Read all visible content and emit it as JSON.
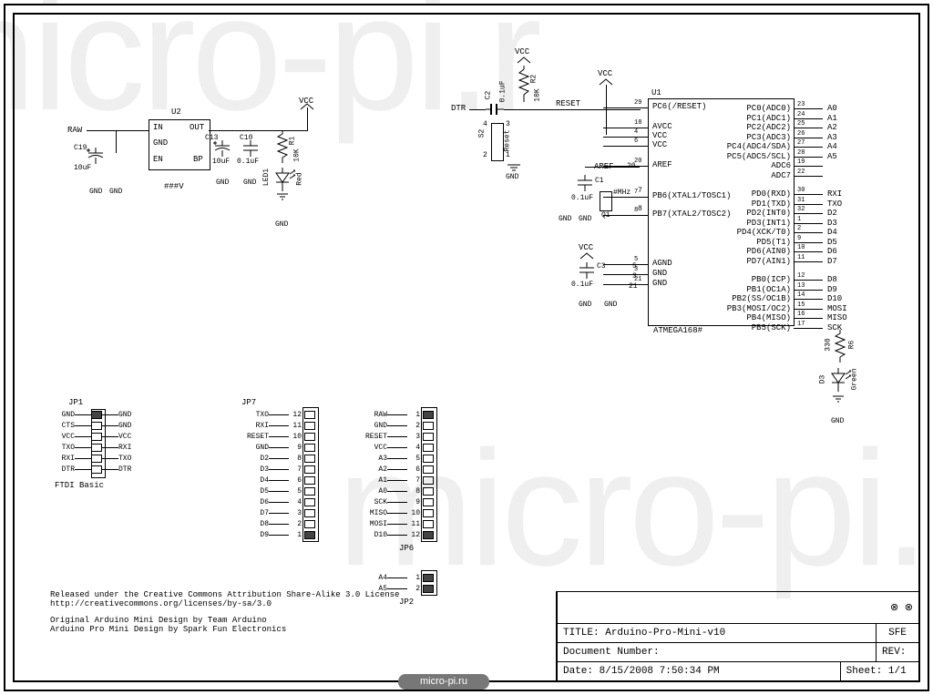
{
  "title_block": {
    "title_label": "TITLE:",
    "title": "Arduino-Pro-Mini-v10",
    "sfe": "SFE",
    "docnum_label": "Document Number:",
    "rev_label": "REV:",
    "date_label": "Date:",
    "date": "8/15/2008 7:50:34 PM",
    "sheet_label": "Sheet:",
    "sheet": "1/1"
  },
  "footer": {
    "license1": "Released under the Creative Commons Attribution Share-Alike 3.0 License",
    "license2": "http://creativecommons.org/licenses/by-sa/3.0",
    "credit1": "Original Arduino Mini Design by Team Arduino",
    "credit2": "Arduino Pro Mini Design by Spark Fun Electronics"
  },
  "watermark": {
    "url": "micro-pi.ru",
    "text": "micro-pi.r"
  },
  "regulator": {
    "u2": "U2",
    "in": "IN",
    "out": "OUT",
    "gnd": "GND",
    "en": "EN",
    "bp": "BP",
    "note": "###V",
    "raw": "RAW",
    "vcc": "VCC",
    "c19": "C19",
    "c19v": "10uF",
    "c13": "C13",
    "c13v": "10uF",
    "c10": "C10",
    "c10v": "0.1uF",
    "r1": "R1",
    "r1v": "10K",
    "led1": "LED1",
    "red": "Red",
    "gnd_lbl": "GND"
  },
  "reset": {
    "dtr": "DTR",
    "vcc": "VCC",
    "reset": "RESET",
    "s2": "S2",
    "s2t": "Reset",
    "c2": "C2",
    "c2v": "0.1uF",
    "r2": "R2",
    "r2v": "10K",
    "gnd": "GND"
  },
  "osc": {
    "aref": "AREF",
    "c1": "C1",
    "c1v": "0.1uF",
    "q1": "Q1",
    "mhz": "#MHz",
    "gnd": "GND",
    "c3": "C3",
    "c3v": "0.1uF",
    "vcc": "VCC"
  },
  "led": {
    "r6": "R6",
    "r6v": "330",
    "d3": "D3",
    "green": "Green",
    "gnd": "GND"
  },
  "ic": {
    "ref": "U1",
    "part": "ATMEGA168#",
    "left": [
      {
        "n": "29",
        "t": "PC6(/RESET)"
      },
      {
        "n": "18",
        "t": "AVCC"
      },
      {
        "n": "4",
        "t": "VCC"
      },
      {
        "n": "6",
        "t": "VCC"
      },
      {
        "n": "20",
        "t": "AREF"
      },
      {
        "n": "7",
        "t": "PB6(XTAL1/TOSC1)"
      },
      {
        "n": "8",
        "t": "PB7(XTAL2/TOSC2)"
      },
      {
        "n": "5",
        "t": "AGND"
      },
      {
        "n": "3",
        "t": "GND"
      },
      {
        "n": "21",
        "t": "GND"
      }
    ],
    "right": [
      {
        "n": "23",
        "t": "PC0(ADC0)",
        "net": "A0"
      },
      {
        "n": "24",
        "t": "PC1(ADC1)",
        "net": "A1"
      },
      {
        "n": "25",
        "t": "PC2(ADC2)",
        "net": "A2"
      },
      {
        "n": "26",
        "t": "PC3(ADC3)",
        "net": "A3"
      },
      {
        "n": "27",
        "t": "PC4(ADC4/SDA)",
        "net": "A4"
      },
      {
        "n": "28",
        "t": "PC5(ADC5/SCL)",
        "net": "A5"
      },
      {
        "n": "19",
        "t": "ADC6",
        "net": ""
      },
      {
        "n": "22",
        "t": "ADC7",
        "net": ""
      },
      {
        "n": "30",
        "t": "PD0(RXD)",
        "net": "RXI"
      },
      {
        "n": "31",
        "t": "PD1(TXD)",
        "net": "TXO"
      },
      {
        "n": "32",
        "t": "PD2(INT0)",
        "net": "D2"
      },
      {
        "n": "1",
        "t": "PD3(INT1)",
        "net": "D3"
      },
      {
        "n": "2",
        "t": "PD4(XCK/T0)",
        "net": "D4"
      },
      {
        "n": "9",
        "t": "PD5(T1)",
        "net": "D5"
      },
      {
        "n": "10",
        "t": "PD6(AIN0)",
        "net": "D6"
      },
      {
        "n": "11",
        "t": "PD7(AIN1)",
        "net": "D7"
      },
      {
        "n": "12",
        "t": "PB0(ICP)",
        "net": "D8"
      },
      {
        "n": "13",
        "t": "PB1(OC1A)",
        "net": "D9"
      },
      {
        "n": "14",
        "t": "PB2(SS/OC1B)",
        "net": "D10"
      },
      {
        "n": "15",
        "t": "PB3(MOSI/OC2)",
        "net": "MOSI"
      },
      {
        "n": "16",
        "t": "PB4(MISO)",
        "net": "MISO"
      },
      {
        "n": "17",
        "t": "PB5(SCK)",
        "net": "SCK"
      }
    ]
  },
  "jp1": {
    "ref": "JP1",
    "note": "FTDI Basic",
    "left": [
      "GND",
      "CTS",
      "VCC",
      "TXO",
      "RXI",
      "DTR"
    ],
    "right": [
      "GND",
      "GND",
      "VCC",
      "RXI",
      "TXO",
      "DTR"
    ]
  },
  "jp7": {
    "ref": "JP7",
    "rows": [
      {
        "n": "12",
        "t": "TXO"
      },
      {
        "n": "11",
        "t": "RXI"
      },
      {
        "n": "10",
        "t": "RESET"
      },
      {
        "n": "9",
        "t": "GND"
      },
      {
        "n": "8",
        "t": "D2"
      },
      {
        "n": "7",
        "t": "D3"
      },
      {
        "n": "6",
        "t": "D4"
      },
      {
        "n": "5",
        "t": "D5"
      },
      {
        "n": "4",
        "t": "D6"
      },
      {
        "n": "3",
        "t": "D7"
      },
      {
        "n": "2",
        "t": "D8"
      },
      {
        "n": "1",
        "t": "D9"
      }
    ]
  },
  "jp6": {
    "ref": "JP6",
    "rows": [
      {
        "n": "1",
        "t": "RAW"
      },
      {
        "n": "2",
        "t": "GND"
      },
      {
        "n": "3",
        "t": "RESET"
      },
      {
        "n": "4",
        "t": "VCC"
      },
      {
        "n": "5",
        "t": "A3"
      },
      {
        "n": "6",
        "t": "A2"
      },
      {
        "n": "7",
        "t": "A1"
      },
      {
        "n": "8",
        "t": "A0"
      },
      {
        "n": "9",
        "t": "SCK"
      },
      {
        "n": "10",
        "t": "MISO"
      },
      {
        "n": "11",
        "t": "MOSI"
      },
      {
        "n": "12",
        "t": "D10"
      }
    ]
  },
  "jp2": {
    "ref": "JP2",
    "rows": [
      {
        "n": "1",
        "t": "A4"
      },
      {
        "n": "2",
        "t": "A5"
      }
    ]
  }
}
